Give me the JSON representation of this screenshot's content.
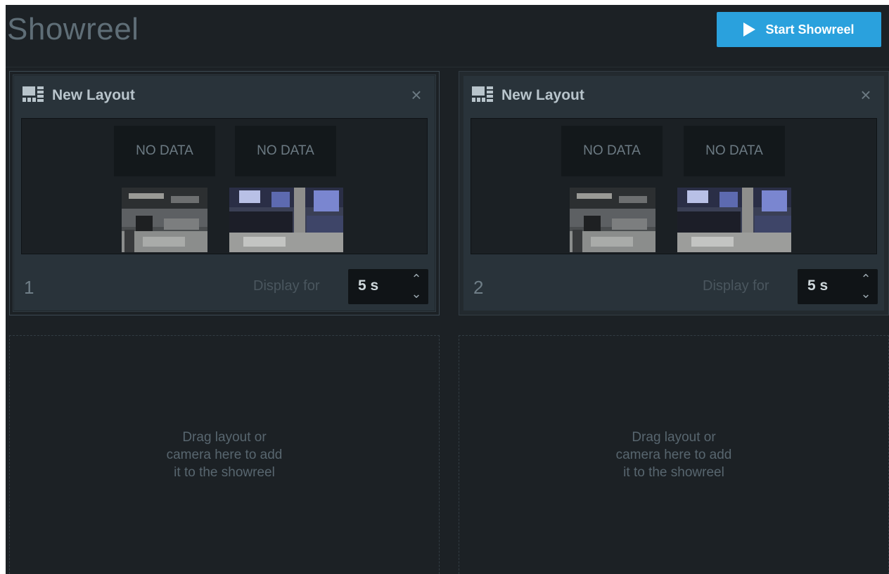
{
  "header": {
    "title": "Showreel",
    "start_button_label": "Start Showreel"
  },
  "colors": {
    "accent": "#2aa1dd",
    "background": "#1c2125",
    "card": "#29333a"
  },
  "items": [
    {
      "layout_name": "New Layout",
      "index": "1",
      "display_label": "Display for",
      "duration": "5 s",
      "tiles": [
        "NO DATA",
        "NO DATA"
      ],
      "selected": true
    },
    {
      "layout_name": "New Layout",
      "index": "2",
      "display_label": "Display for",
      "duration": "5 s",
      "tiles": [
        "NO DATA",
        "NO DATA"
      ],
      "selected": false
    }
  ],
  "drop_zones": [
    {
      "lines": [
        "Drag layout or",
        "camera here to add",
        "it to the showreel"
      ]
    },
    {
      "lines": [
        "Drag layout or",
        "camera here to add",
        "it to the showreel"
      ]
    }
  ],
  "icons": {
    "layout": "layout-grid-icon",
    "close": "close-icon",
    "play": "play-icon",
    "stepper_up": "chevron-up-icon",
    "stepper_down": "chevron-down-icon"
  }
}
